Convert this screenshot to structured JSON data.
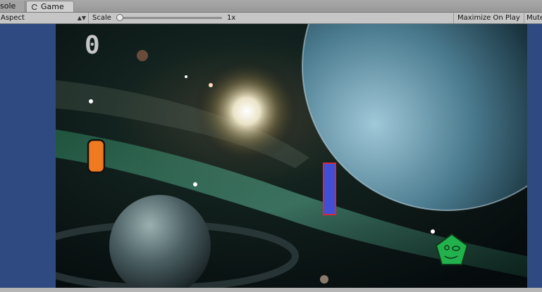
{
  "tabs": [
    {
      "label": "Console",
      "visible": "sole"
    },
    {
      "label": "Game",
      "icon": "game-controller-icon",
      "active": true
    }
  ],
  "toolbar": {
    "aspect_label": "Aspect",
    "scale_label": "Scale",
    "scale_value": "1x",
    "maximize_label": "Maximize On Play",
    "mute_label": "Mute"
  },
  "game": {
    "score": "0"
  },
  "colors": {
    "letterbox": "#2f4a80",
    "left_paddle": "#f07a20",
    "right_paddle": "#3f4fd6",
    "right_paddle_border": "#d8283c",
    "ball_pentagon": "#22b14c",
    "score": "#d8d8d8"
  }
}
